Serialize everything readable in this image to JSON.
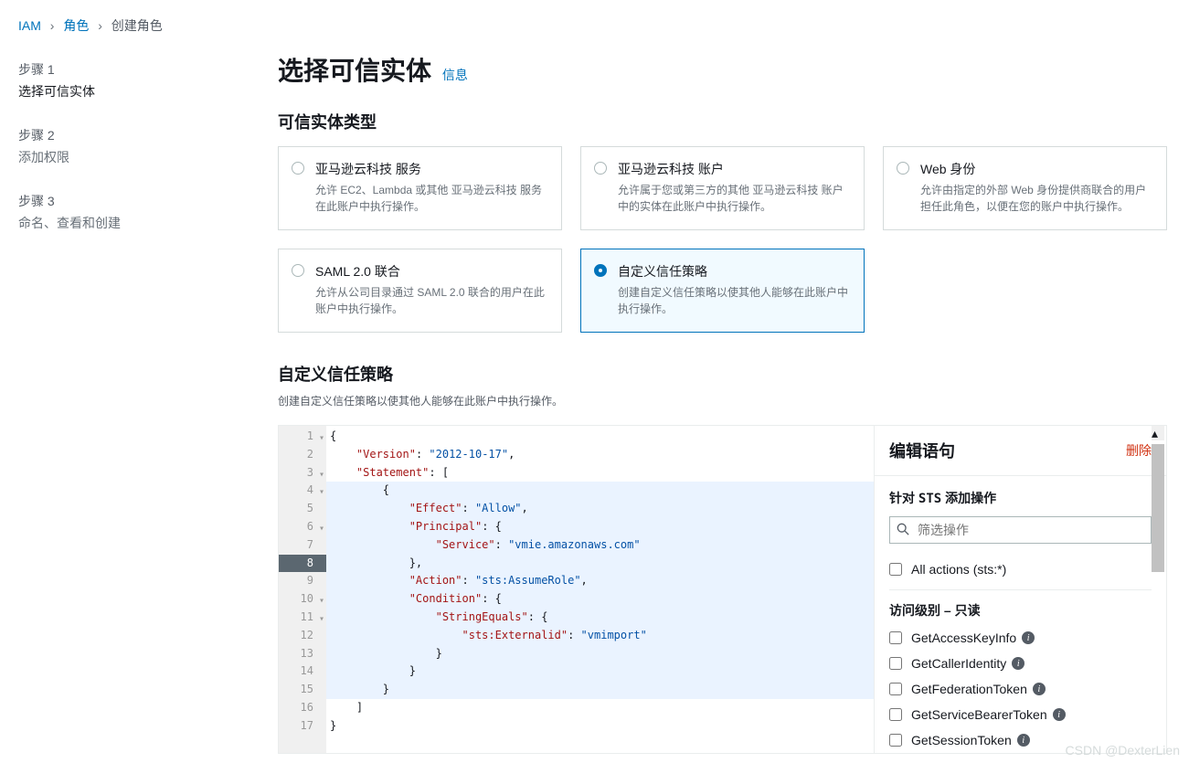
{
  "breadcrumb": {
    "root": "IAM",
    "roles": "角色",
    "current": "创建角色"
  },
  "steps": [
    {
      "label": "步骤 1",
      "title": "选择可信实体",
      "active": true
    },
    {
      "label": "步骤 2",
      "title": "添加权限",
      "active": false
    },
    {
      "label": "步骤 3",
      "title": "命名、查看和创建",
      "active": false
    }
  ],
  "heading": "选择可信实体",
  "info_label": "信息",
  "entity_section_title": "可信实体类型",
  "entities": [
    {
      "title": "亚马逊云科技 服务",
      "desc": "允许 EC2、Lambda 或其他 亚马逊云科技 服务在此账户中执行操作。",
      "selected": false
    },
    {
      "title": "亚马逊云科技 账户",
      "desc": "允许属于您或第三方的其他 亚马逊云科技 账户中的实体在此账户中执行操作。",
      "selected": false
    },
    {
      "title": "Web 身份",
      "desc": "允许由指定的外部 Web 身份提供商联合的用户担任此角色，以便在您的账户中执行操作。",
      "selected": false
    },
    {
      "title": "SAML 2.0 联合",
      "desc": "允许从公司目录通过 SAML 2.0 联合的用户在此账户中执行操作。",
      "selected": false
    },
    {
      "title": "自定义信任策略",
      "desc": "创建自定义信任策略以使其他人能够在此账户中执行操作。",
      "selected": true
    }
  ],
  "custom_policy": {
    "title": "自定义信任策略",
    "subtitle": "创建自定义信任策略以使其他人能够在此账户中执行操作。"
  },
  "code": {
    "line_numbers": [
      "1",
      "2",
      "3",
      "4",
      "5",
      "6",
      "7",
      "8",
      "9",
      "10",
      "11",
      "12",
      "13",
      "14",
      "15",
      "16",
      "17"
    ],
    "tokens": {
      "version_key": "\"Version\"",
      "version_val": "\"2012-10-17\"",
      "statement_key": "\"Statement\"",
      "effect_key": "\"Effect\"",
      "effect_val": "\"Allow\"",
      "principal_key": "\"Principal\"",
      "service_key": "\"Service\"",
      "service_val": "\"vmie.amazonaws.com\"",
      "action_key": "\"Action\"",
      "action_val": "\"sts:AssumeRole\"",
      "condition_key": "\"Condition\"",
      "stringequals_key": "\"StringEquals\"",
      "externalid_key": "\"sts:Externalid\"",
      "externalid_val": "\"vmimport\""
    }
  },
  "right_panel": {
    "title": "编辑语句",
    "delete": "删除",
    "add_ops_prefix": "针对 ",
    "add_ops_service": "STS",
    "add_ops_suffix": " 添加操作",
    "search_placeholder": "筛选操作",
    "all_actions": "All actions (sts:*)",
    "access_level": "访问级别 – 只读",
    "actions": [
      "GetAccessKeyInfo",
      "GetCallerIdentity",
      "GetFederationToken",
      "GetServiceBearerToken",
      "GetSessionToken"
    ]
  },
  "watermark": "CSDN @DexterLien"
}
